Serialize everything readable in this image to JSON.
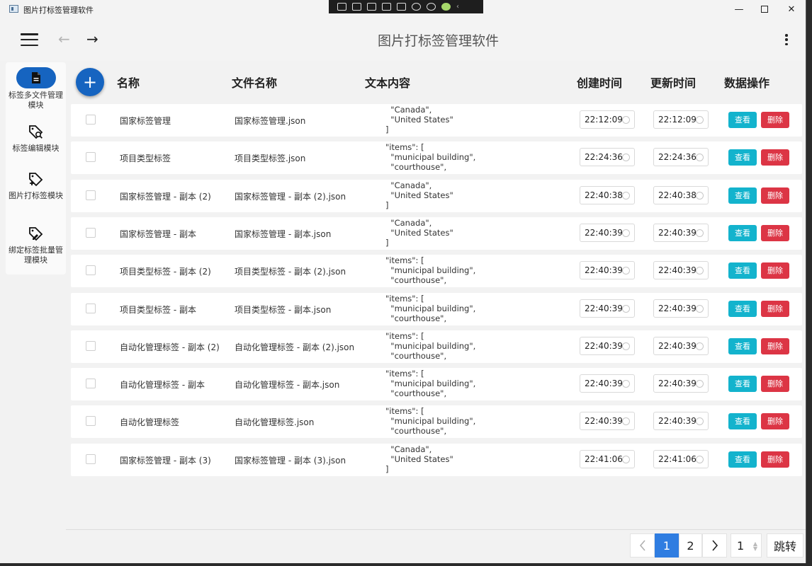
{
  "window": {
    "title": "图片打标签管理软件"
  },
  "appbar": {
    "title": "图片打标签管理软件"
  },
  "sidebar": {
    "items": [
      {
        "label": "标签多文件管理模块",
        "icon": "file-icon",
        "active": true
      },
      {
        "label": "标签编辑模块",
        "icon": "tag-search-icon",
        "active": false
      },
      {
        "label": "图片打标签模块",
        "icon": "tag-add-icon",
        "active": false
      },
      {
        "label": "绑定标签批量管理模块",
        "icon": "tag-edit-icon",
        "active": false
      }
    ]
  },
  "table": {
    "headers": {
      "name": "名称",
      "file": "文件名称",
      "text": "文本内容",
      "created": "创建时间",
      "updated": "更新时间",
      "actions": "数据操作"
    },
    "view_label": "查看",
    "delete_label": "删除",
    "rows": [
      {
        "name": "国家标签管理",
        "file": "国家标签管理.json",
        "text": "  \"Canada\",\n  \"United States\"\n]",
        "created": "22:12:09",
        "updated": "22:12:09"
      },
      {
        "name": "项目类型标签",
        "file": "项目类型标签.json",
        "text": "\"items\": [\n  \"municipal building\",\n  \"courthouse\",",
        "created": "22:24:36",
        "updated": "22:24:36"
      },
      {
        "name": "国家标签管理 - 副本 (2)",
        "file": "国家标签管理 - 副本 (2).json",
        "text": "  \"Canada\",\n  \"United States\"\n]",
        "created": "22:40:38",
        "updated": "22:40:38"
      },
      {
        "name": "国家标签管理 - 副本",
        "file": "国家标签管理 - 副本.json",
        "text": "  \"Canada\",\n  \"United States\"\n]",
        "created": "22:40:39",
        "updated": "22:40:39"
      },
      {
        "name": "项目类型标签 - 副本 (2)",
        "file": "项目类型标签 - 副本 (2).json",
        "text": "\"items\": [\n  \"municipal building\",\n  \"courthouse\",",
        "created": "22:40:39",
        "updated": "22:40:39"
      },
      {
        "name": "项目类型标签 - 副本",
        "file": "项目类型标签 - 副本.json",
        "text": "\"items\": [\n  \"municipal building\",\n  \"courthouse\",",
        "created": "22:40:39",
        "updated": "22:40:39"
      },
      {
        "name": "自动化管理标签 - 副本 (2)",
        "file": "自动化管理标签 - 副本 (2).json",
        "text": "\"items\": [\n  \"municipal building\",\n  \"courthouse\",",
        "created": "22:40:39",
        "updated": "22:40:39"
      },
      {
        "name": "自动化管理标签 - 副本",
        "file": "自动化管理标签 - 副本.json",
        "text": "\"items\": [\n  \"municipal building\",\n  \"courthouse\",",
        "created": "22:40:39",
        "updated": "22:40:39"
      },
      {
        "name": "自动化管理标签",
        "file": "自动化管理标签.json",
        "text": "\"items\": [\n  \"municipal building\",\n  \"courthouse\",",
        "created": "22:40:39",
        "updated": "22:40:39"
      },
      {
        "name": "国家标签管理 - 副本 (3)",
        "file": "国家标签管理 - 副本 (3).json",
        "text": "  \"Canada\",\n  \"United States\"\n]",
        "created": "22:41:06",
        "updated": "22:41:06"
      }
    ]
  },
  "pagination": {
    "pages": [
      "1",
      "2"
    ],
    "current": "1",
    "jump_value": "1",
    "jump_label": "跳转"
  },
  "colors": {
    "primary": "#1664c0",
    "view_button": "#13b3cd",
    "delete_button": "#dc3545",
    "page_active": "#2f7de1"
  }
}
